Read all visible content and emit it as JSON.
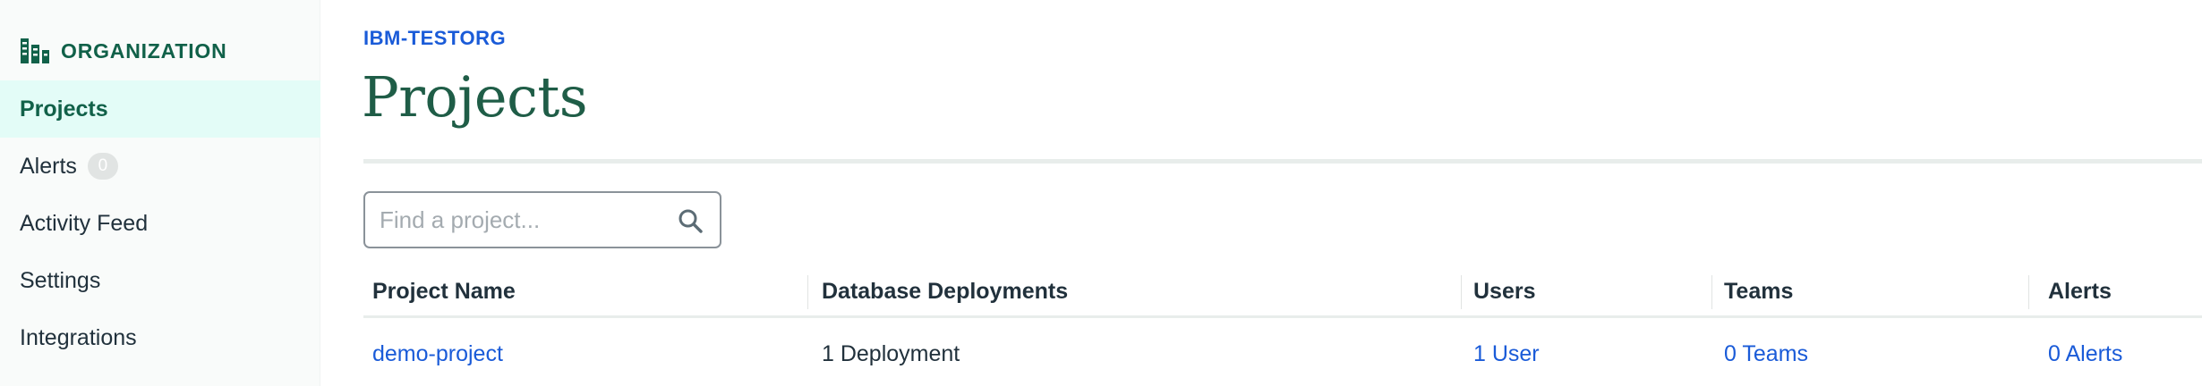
{
  "sidebar": {
    "org_label": "ORGANIZATION",
    "org_icon": "organization-building-icon",
    "items": [
      {
        "label": "Projects",
        "active": true
      },
      {
        "label": "Alerts",
        "badge": "0"
      },
      {
        "label": "Activity Feed"
      },
      {
        "label": "Settings"
      },
      {
        "label": "Integrations"
      }
    ]
  },
  "main": {
    "breadcrumb": "IBM-TESTORG",
    "title": "Projects",
    "search": {
      "placeholder": "Find a project...",
      "value": "",
      "icon": "search-icon"
    },
    "table": {
      "columns": [
        "Project Name",
        "Database Deployments",
        "Users",
        "Teams",
        "Alerts"
      ],
      "rows": [
        {
          "project_name": "demo-project",
          "deployments": "1 Deployment",
          "users": "1 User",
          "teams": "0 Teams",
          "alerts": "0 Alerts"
        }
      ]
    }
  },
  "colors": {
    "brand_green": "#116149",
    "title_green": "#1f5d47",
    "link_blue": "#1a5bd8",
    "active_bg": "#e3fcf7",
    "sidebar_bg": "#f9fbfa"
  }
}
